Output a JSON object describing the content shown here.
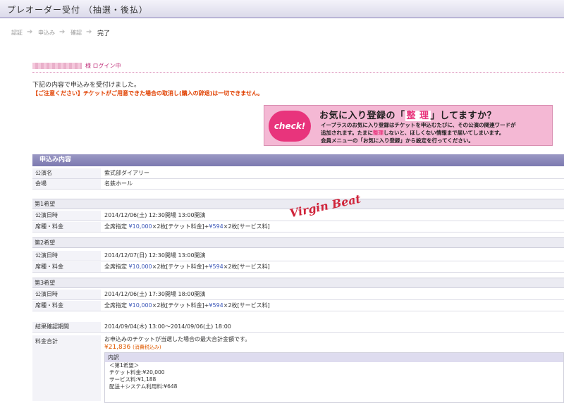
{
  "title": "プレオーダー受付 （抽選・後払）",
  "steps": [
    "認証",
    "申込み",
    "確認",
    "完了"
  ],
  "login_suffix": "様 ログイン中",
  "message": "下記の内容で申込みを受付けました。",
  "warning": "【ご注意ください】チケットがご用意できた場合の取消し(購入の辞退)は一切できません。",
  "banner": {
    "badge": "check!",
    "headline_pre": "お気に入り登録の「",
    "headline_hl": "整 理",
    "headline_post": "」してますか？",
    "line1": "イープラスのお気に入り登録はチケットを申込むたびに、その公演の関連ワードが",
    "line2_pre": "追加されます。たまに",
    "line2_hl": "整理",
    "line2_post": "しないと、ほしくない情報まで届いてしまいます。",
    "line3": "会員メニューの「お気に入り登録」から設定を行ってください。"
  },
  "panel_title": "申込み内容",
  "performance_label": "公演名",
  "performance_value": "紫式部ダイアリー",
  "venue_label": "会場",
  "venue_value": "名鉄ホール",
  "date_label": "公演日時",
  "seat_label": "席種・料金",
  "seat_prefix": "全席指定 ",
  "ticket_price": "¥10,000",
  "ticket_part": "×2枚[チケット料金]+",
  "service_price": "¥594",
  "service_part": "×2枚[サービス料]",
  "choices": [
    {
      "title": "第1希望",
      "date": "2014/12/06(土) 12:30開場 13:00開演"
    },
    {
      "title": "第2希望",
      "date": "2014/12/07(日) 12:30開場 13:00開演"
    },
    {
      "title": "第3希望",
      "date": "2014/12/06(土) 17:30開場 18:00開演"
    }
  ],
  "result_label": "結果確認期間",
  "result_value": "2014/09/04(木) 13:00～2014/09/06(土) 18:00",
  "total_label": "料金合計",
  "total_note": "お申込みのチケットが当選した場合の最大合計金額です。",
  "total_amount": "¥21,836",
  "total_tax": "(消費税込み)",
  "breakdown_title": "内訳",
  "breakdown_lines": [
    "＜第1希望＞",
    "チケット料金:¥20,000",
    "サービス料:¥1,188",
    "配送＋システム利用料:¥648"
  ],
  "watermark": "Virgin Beat"
}
